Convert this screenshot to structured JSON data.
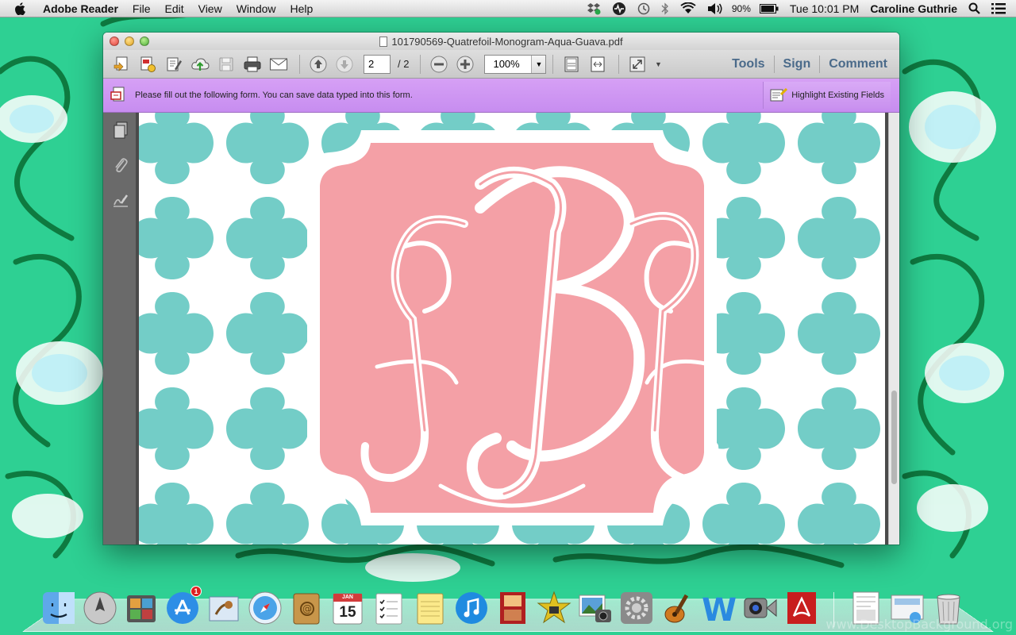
{
  "menubar": {
    "app_name": "Adobe Reader",
    "menus": [
      "File",
      "Edit",
      "View",
      "Window",
      "Help"
    ],
    "battery": "90%",
    "clock": "Tue 10:01 PM",
    "user": "Caroline Guthrie"
  },
  "window": {
    "title": "101790569-Quatrefoil-Monogram-Aqua-Guava.pdf",
    "page_current": "2",
    "page_total": "/ 2",
    "zoom": "100%",
    "links": {
      "tools": "Tools",
      "sign": "Sign",
      "comment": "Comment"
    },
    "form_message": "Please fill out the following form. You can save data typed into this form.",
    "highlight_label": "Highlight Existing Fields"
  },
  "document": {
    "monogram_letters": "JBJ",
    "colors": {
      "aqua": "#73cdc7",
      "guava": "#f4a0a6",
      "white": "#ffffff"
    }
  },
  "dock": {
    "apps": [
      "finder-icon",
      "launchpad-icon",
      "photo-booth-icon",
      "app-store-icon",
      "mail-icon",
      "safari-icon",
      "contacts-icon",
      "calendar-icon",
      "reminders-icon",
      "notes-icon",
      "itunes-icon",
      "photo-booth-strip-icon",
      "imovie-icon",
      "iphoto-icon",
      "system-preferences-icon",
      "garageband-icon",
      "word-icon",
      "facetime-icon",
      "acrobat-icon"
    ],
    "app_store_badge": "1",
    "calendar_day": "15",
    "calendar_month": "JAN"
  },
  "watermark": "www.DesktopBackground.org"
}
